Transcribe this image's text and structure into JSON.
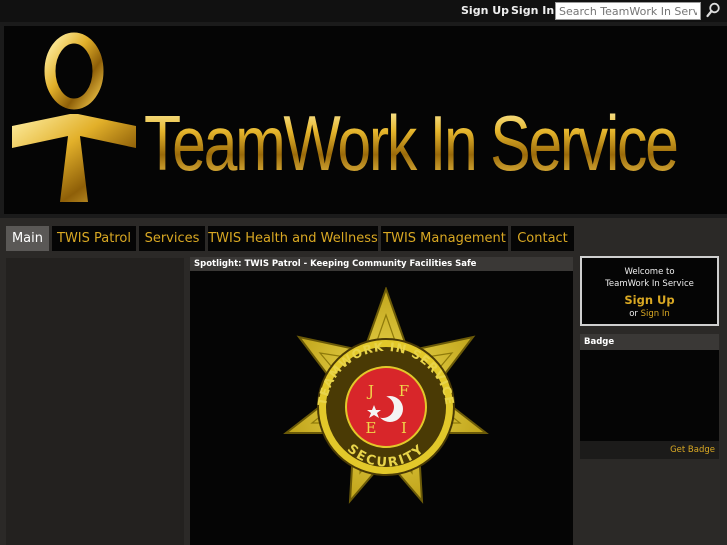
{
  "topbar": {
    "signup_label": "Sign Up",
    "signin_label": "Sign In",
    "search_placeholder": "Search TeamWork In Service"
  },
  "header": {
    "site_title": "TeamWork In Service"
  },
  "nav": {
    "tabs": [
      {
        "label": "Main",
        "active": true
      },
      {
        "label": "TWIS Patrol"
      },
      {
        "label": "Services"
      },
      {
        "label": "TWIS Health and Wellness"
      },
      {
        "label": "TWIS Management"
      },
      {
        "label": "Contact"
      }
    ]
  },
  "spotlight": {
    "heading": "Spotlight: TWIS Patrol - Keeping Community Facilities Safe",
    "badge_text_top": "TEAMWORK IN SERVICE",
    "badge_text_bottom": "SECURITY",
    "badge_letters": [
      "J",
      "F",
      "E",
      "I"
    ]
  },
  "welcome": {
    "line1": "Welcome to",
    "line2": "TeamWork In Service",
    "signup_label": "Sign Up",
    "or_label": "or",
    "signin_label": "Sign In"
  },
  "badge_widget": {
    "title": "Badge",
    "get_badge_label": "Get Badge"
  },
  "colors": {
    "accent_gold": "#d9a823",
    "background": "#2b2927",
    "panel": "#050505"
  }
}
